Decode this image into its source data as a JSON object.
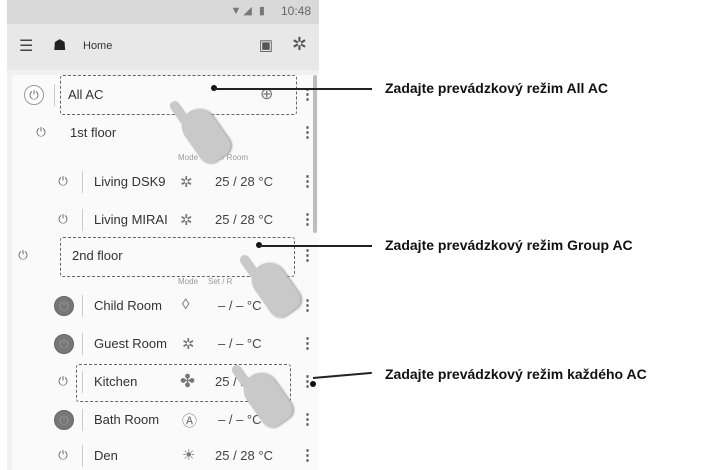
{
  "status_bar": {
    "time": "10:48",
    "icons": "▼◢ ▮"
  },
  "toolbar": {
    "menu_icon": "☰",
    "home_icon": "☗",
    "title": "Home",
    "calendar_icon": "▣",
    "settings_icon": "✲"
  },
  "list": {
    "all_ac": {
      "label": "All AC"
    },
    "group1": {
      "label": "1st floor",
      "col_mode": "Mode",
      "col_set": "Set / Room"
    },
    "unit1": {
      "label": "Living DSK9",
      "mode": "✲",
      "set_room": "25 / 28  °C"
    },
    "unit2": {
      "label": "Living MIRAI",
      "mode": "✲",
      "set_room": "25 / 28  °C"
    },
    "group2": {
      "label": "2nd floor",
      "col_mode": "Mode",
      "col_set": "Set / R"
    },
    "unit3": {
      "label": "Child Room",
      "mode": "◊",
      "set_room": "– / –   °C"
    },
    "unit4": {
      "label": "Guest Room",
      "mode": "✲",
      "set_room": "– / –   °C"
    },
    "unit5": {
      "label": "Kitchen",
      "mode": "✤",
      "set_room": "25 / 28  °C"
    },
    "unit6": {
      "label": "Bath Room",
      "mode": "Ⓐ",
      "set_room": "– / –   °C"
    },
    "unit7": {
      "label": "Den",
      "mode": "☀",
      "set_room": "25 / 28  °C"
    },
    "power_glyph": "⏻",
    "more_glyph": "⋮"
  },
  "callouts": {
    "c1": "Zadajte prevádzkový režim All AC",
    "c2": "Zadajte prevádzkový režim Group AC",
    "c3": "Zadajte prevádzkový režim každého AC"
  }
}
